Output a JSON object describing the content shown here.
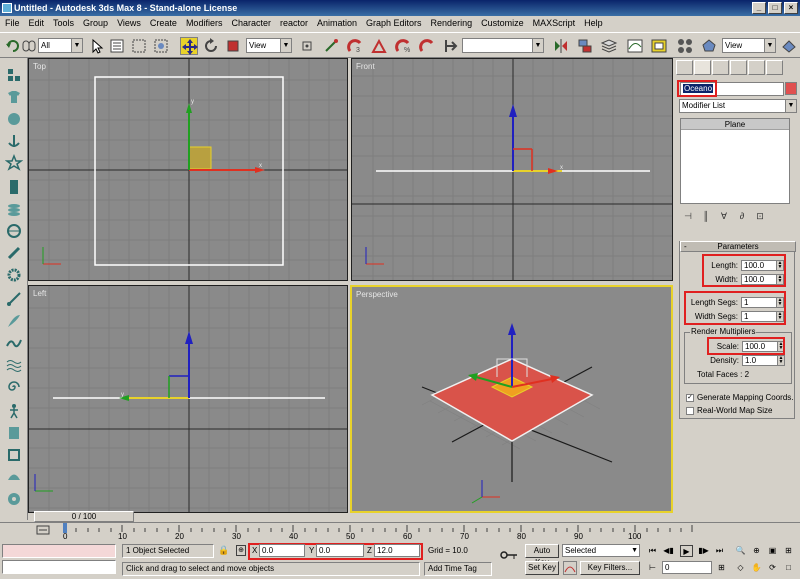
{
  "window": {
    "title": "Untitled - Autodesk 3ds Max 8 - Stand-alone License"
  },
  "menu": [
    "File",
    "Edit",
    "Tools",
    "Group",
    "Views",
    "Create",
    "Modifiers",
    "Character",
    "reactor",
    "Animation",
    "Graph Editors",
    "Rendering",
    "Customize",
    "MAXScript",
    "Help"
  ],
  "toolbar": {
    "selection_filter": "All",
    "ref_coord": "View",
    "named_selection": "",
    "render_view": "View"
  },
  "viewports": {
    "top": "Top",
    "front": "Front",
    "left": "Left",
    "perspective": "Perspective"
  },
  "command_panel": {
    "object_name": "Oceano",
    "modifier_list": "Modifier List",
    "stack_item": "Plane",
    "rollout_title": "Parameters",
    "length_label": "Length:",
    "length_value": "100.0",
    "width_label": "Width:",
    "width_value": "100.0",
    "length_segs_label": "Length Segs:",
    "length_segs_value": "1",
    "width_segs_label": "Width Segs:",
    "width_segs_value": "1",
    "render_mult_title": "Render Multipliers",
    "scale_label": "Scale:",
    "scale_value": "100.0",
    "density_label": "Density:",
    "density_value": "1.0",
    "total_faces": "Total Faces : 2",
    "gen_mapping": "Generate Mapping Coords.",
    "real_world": "Real-World Map Size",
    "gen_mapping_checked": true,
    "real_world_checked": false
  },
  "timeline": {
    "frame": "0 / 100",
    "ticks": [
      "0",
      "10",
      "20",
      "30",
      "40",
      "50",
      "60",
      "70",
      "80",
      "90",
      "100"
    ]
  },
  "status": {
    "selected": "1 Object Selected",
    "prompt": "Click and drag to select and move objects",
    "x_label": "X",
    "x": "0.0",
    "y_label": "Y",
    "y": "0.0",
    "z_label": "Z",
    "z": "12.0",
    "grid": "Grid = 10.0",
    "add_time_tag": "Add Time Tag",
    "auto_key": "Auto Key",
    "set_key": "Set Key",
    "key_mode": "Selected",
    "key_filters": "Key Filters...",
    "current_frame": "0"
  },
  "colors": {
    "accent_highlight": "#e02020",
    "active_viewport": "#e8d22a",
    "plane_fill": "#d9534a",
    "viewport_bg": "#8a8a8a"
  }
}
